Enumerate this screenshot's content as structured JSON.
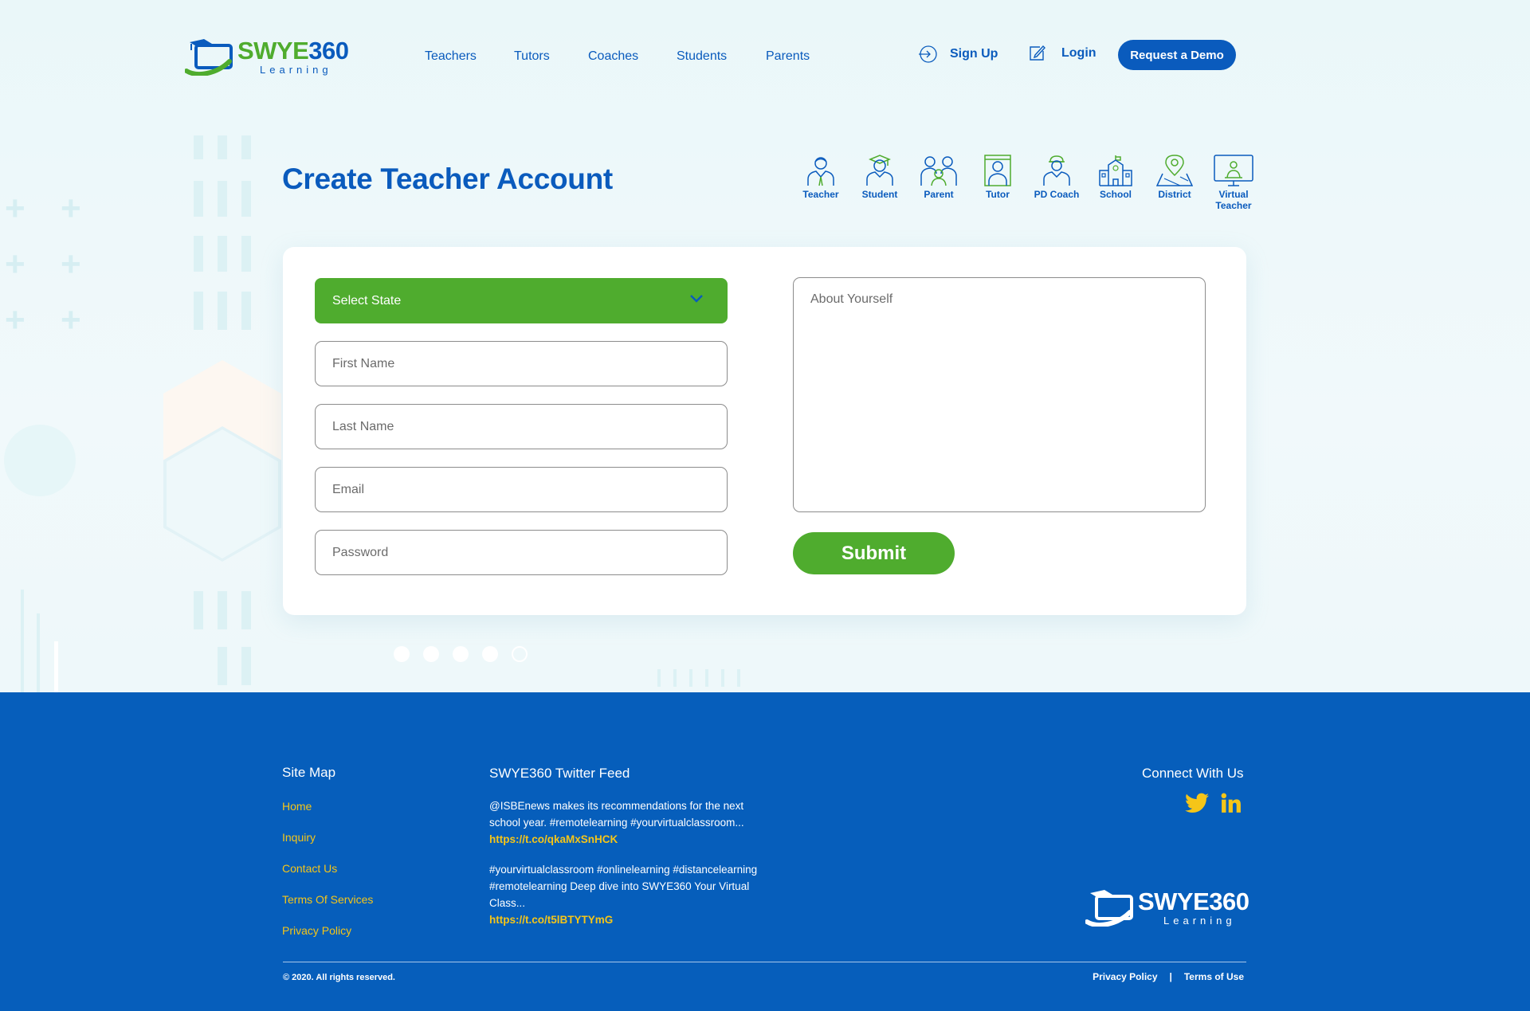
{
  "brand": {
    "name_green": "SWYE",
    "name_blue": "360",
    "subtitle": "Learning",
    "colors": {
      "primary_blue": "#0a5bbd",
      "accent_green": "#4fac2e",
      "footer_blue": "#065ebb",
      "link_yellow": "#f5c518"
    }
  },
  "nav": {
    "items": [
      {
        "label": "Teachers"
      },
      {
        "label": "Tutors"
      },
      {
        "label": "Coaches"
      },
      {
        "label": "Students"
      },
      {
        "label": "Parents"
      }
    ],
    "signup_label": "Sign Up",
    "signup_icon": "sign-in-arrow-icon",
    "login_label": "Login",
    "login_icon": "edit-pencil-icon",
    "demo_label": "Request a Demo"
  },
  "page": {
    "title": "Create Teacher Account"
  },
  "roles": [
    {
      "label": "Teacher",
      "icon": "teacher-icon"
    },
    {
      "label": "Student",
      "icon": "student-icon"
    },
    {
      "label": "Parent",
      "icon": "parent-icon"
    },
    {
      "label": "Tutor",
      "icon": "tutor-icon"
    },
    {
      "label": "PD Coach",
      "icon": "pd-coach-icon"
    },
    {
      "label": "School",
      "icon": "school-icon"
    },
    {
      "label": "District",
      "icon": "district-icon"
    },
    {
      "label": "Virtual\nTeacher",
      "icon": "virtual-teacher-icon"
    }
  ],
  "form": {
    "state_select_label": "Select State",
    "first_name_placeholder": "First Name",
    "last_name_placeholder": "Last Name",
    "email_placeholder": "Email",
    "password_placeholder": "Password",
    "about_placeholder": "About Yourself",
    "submit_label": "Submit"
  },
  "footer": {
    "sitemap_title": "Site Map",
    "sitemap_links": [
      "Home",
      "Inquiry",
      "Contact Us",
      "Terms Of Services",
      "Privacy Policy"
    ],
    "twitter_title": "SWYE360 Twitter Feed",
    "tweets": [
      {
        "text": "@ISBEnews makes its recommendations for the next school year. #remotelearning #yourvirtualclassroom...",
        "link": "https://t.co/qkaMxSnHCK"
      },
      {
        "text": "#yourvirtualclassroom #onlinelearning #distancelearning #remotelearning Deep dive into SWYE360 Your Virtual Class...",
        "link": "https://t.co/t5lBTYTYmG"
      }
    ],
    "connect_title": "Connect With Us",
    "social_icons": [
      "twitter-icon",
      "linkedin-icon"
    ],
    "logo_name": "SWYE360",
    "logo_subtitle": "Learning",
    "copyright": "© 2020. All rights reserved.",
    "privacy_label": "Privacy Policy",
    "separator": "|",
    "terms_label": "Terms of Use"
  }
}
